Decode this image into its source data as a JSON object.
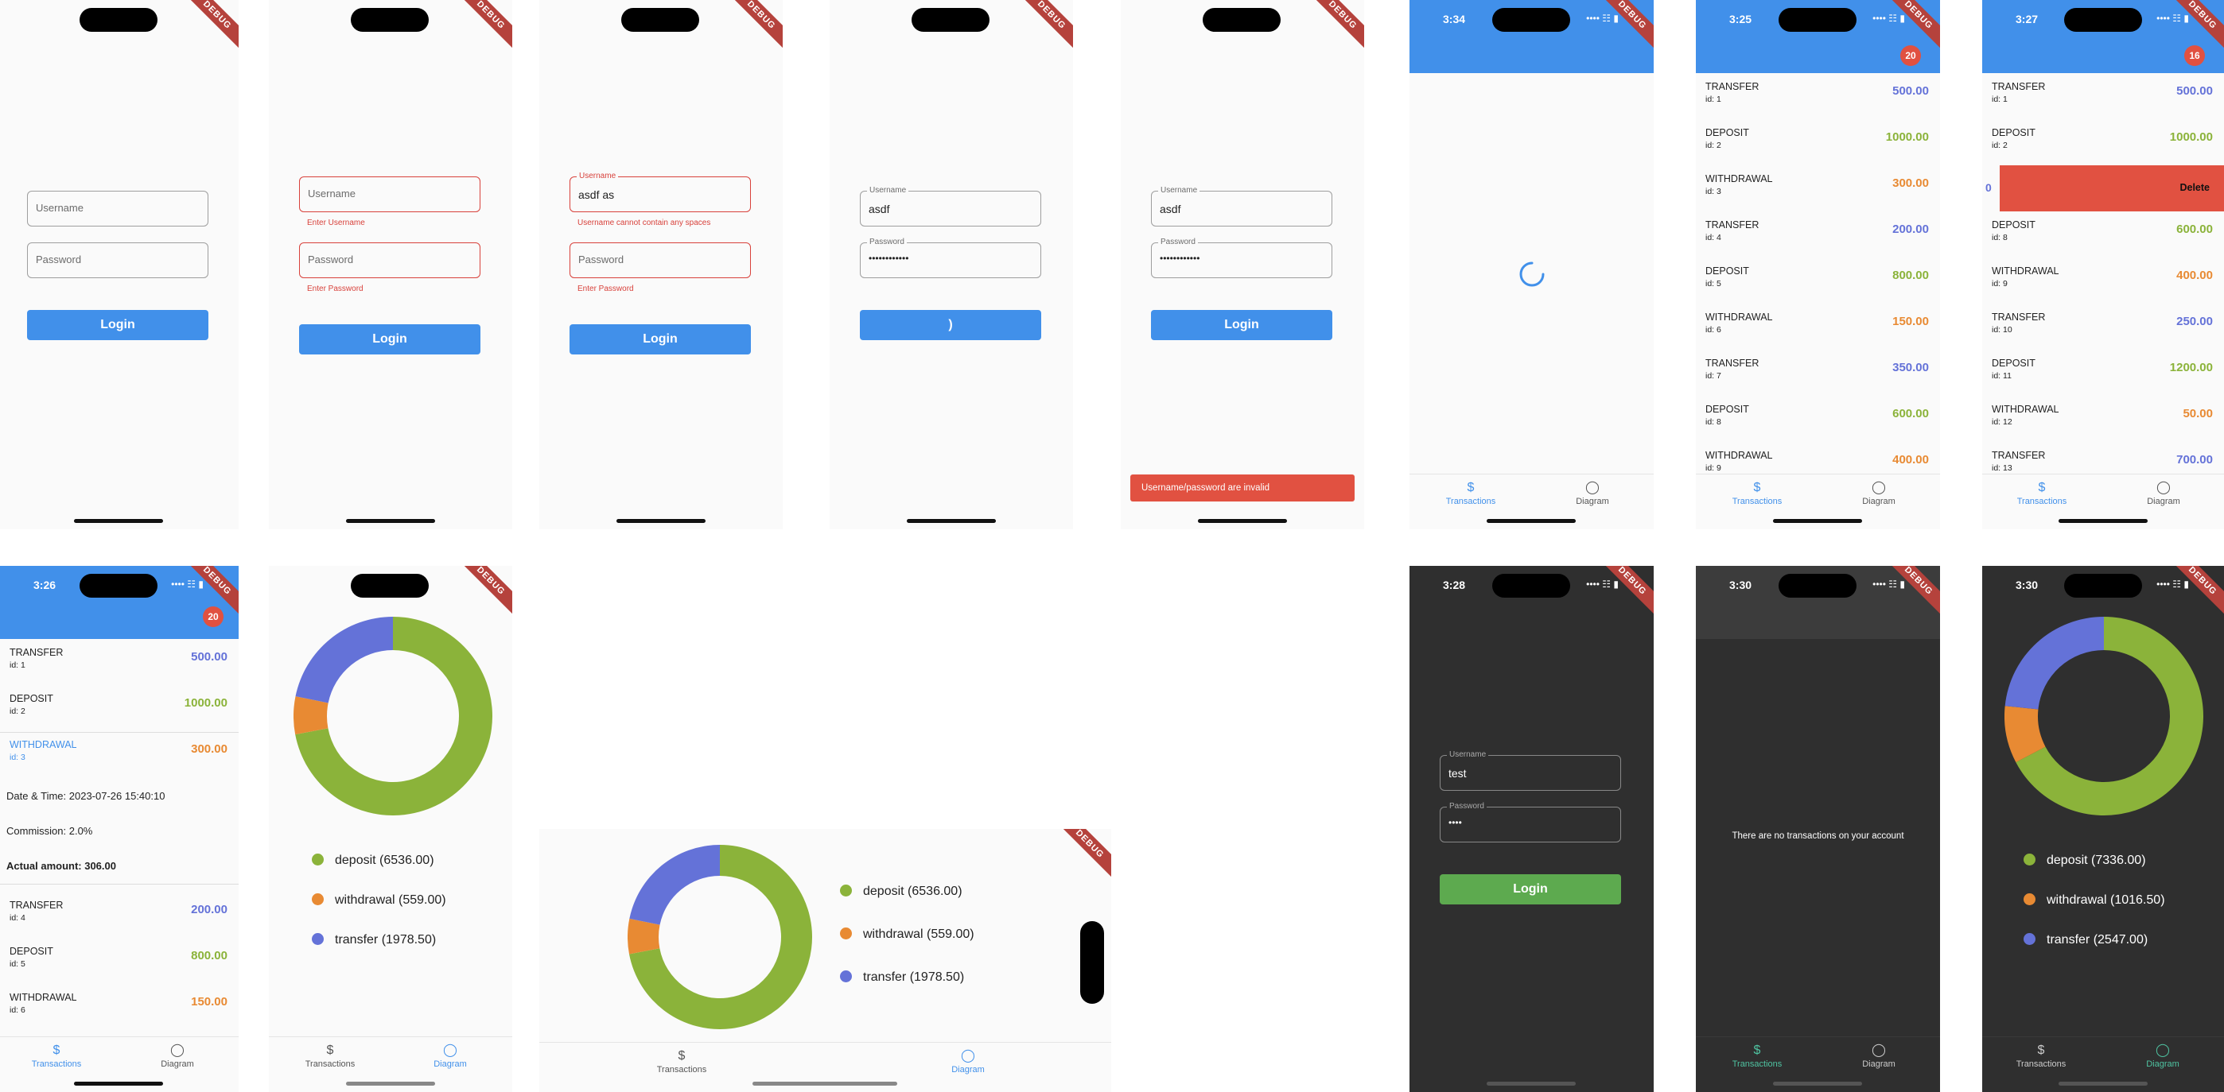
{
  "app": {
    "debug_ribbon": "DEBUG"
  },
  "colors": {
    "primary": "#4190ea",
    "error": "#d8413b",
    "deposit": "#8bb33a",
    "withdrawal": "#e88a33",
    "transfer": "#6472d8",
    "dark_bg": "#2f2f2f",
    "dark_accent": "#5daa4f",
    "dark_tab": "#4fc3a1"
  },
  "login": {
    "username_placeholder": "Username",
    "password_placeholder": "Password",
    "login_label": "Login",
    "username_label": "Username",
    "password_label": "Password",
    "enter_username": "Enter Username",
    "enter_password": "Enter Password",
    "username_spaces_error": "Username cannot contain any spaces",
    "invalid_value": "asdf as",
    "valid_value": "asdf",
    "password_masked": "••••••••••••",
    "loading_glyph": ")",
    "snackbar": "Username/password are invalid",
    "dark_username": "test",
    "dark_password_masked": "••••"
  },
  "times": {
    "loading": "3:34",
    "list": "3:25",
    "swipe": "3:27",
    "expanded": "3:26",
    "dark_login": "3:28",
    "dark_empty": "3:30",
    "dark_chart": "3:30"
  },
  "badges": {
    "list": "20",
    "swipe": "16",
    "expanded": "20"
  },
  "tabs": {
    "transactions": "Transactions",
    "diagram": "Diagram",
    "transactions_icon": "$"
  },
  "transactions": [
    {
      "type": "TRANSFER",
      "id": "id: 1",
      "amount": "500.00"
    },
    {
      "type": "DEPOSIT",
      "id": "id: 2",
      "amount": "1000.00"
    },
    {
      "type": "WITHDRAWAL",
      "id": "id: 3",
      "amount": "300.00"
    },
    {
      "type": "TRANSFER",
      "id": "id: 4",
      "amount": "200.00"
    },
    {
      "type": "DEPOSIT",
      "id": "id: 5",
      "amount": "800.00"
    },
    {
      "type": "WITHDRAWAL",
      "id": "id: 6",
      "amount": "150.00"
    },
    {
      "type": "TRANSFER",
      "id": "id: 7",
      "amount": "350.00"
    },
    {
      "type": "DEPOSIT",
      "id": "id: 8",
      "amount": "600.00"
    },
    {
      "type": "WITHDRAWAL",
      "id": "id: 9",
      "amount": "400.00"
    },
    {
      "type": "TRANSFER",
      "id": "id: 10",
      "amount": "250.00"
    },
    {
      "type": "DEPOSIT",
      "id": "id: 11",
      "amount": "1200.00"
    },
    {
      "type": "WITHDRAWAL",
      "id": "id: 12",
      "amount": "50.00"
    },
    {
      "type": "TRANSFER",
      "id": "id: 13",
      "amount": "700.00"
    }
  ],
  "swipe": {
    "delete_label": "Delete",
    "peek_amount": "0"
  },
  "details": {
    "datetime": "Date & Time: 2023-07-26 15:40:10",
    "commission": "Commission: 2.0%",
    "actual": "Actual amount: 306.00"
  },
  "empty_message": "There are no transactions on your account",
  "chart_data": [
    {
      "type": "pie",
      "donut": true,
      "labels": [
        "deposit (6536.00)",
        "withdrawal (559.00)",
        "transfer (1978.50)"
      ],
      "values": [
        6536.0,
        559.0,
        1978.5
      ],
      "legend_position": "bottom"
    },
    {
      "type": "pie",
      "donut": true,
      "labels": [
        "deposit (6536.00)",
        "withdrawal (559.00)",
        "transfer (1978.50)"
      ],
      "values": [
        6536.0,
        559.0,
        1978.5
      ],
      "legend_position": "right"
    },
    {
      "type": "pie",
      "donut": true,
      "labels": [
        "deposit (7336.00)",
        "withdrawal (1016.50)",
        "transfer (2547.00)"
      ],
      "values": [
        7336.0,
        1016.5,
        2547.0
      ],
      "legend_position": "bottom"
    }
  ]
}
